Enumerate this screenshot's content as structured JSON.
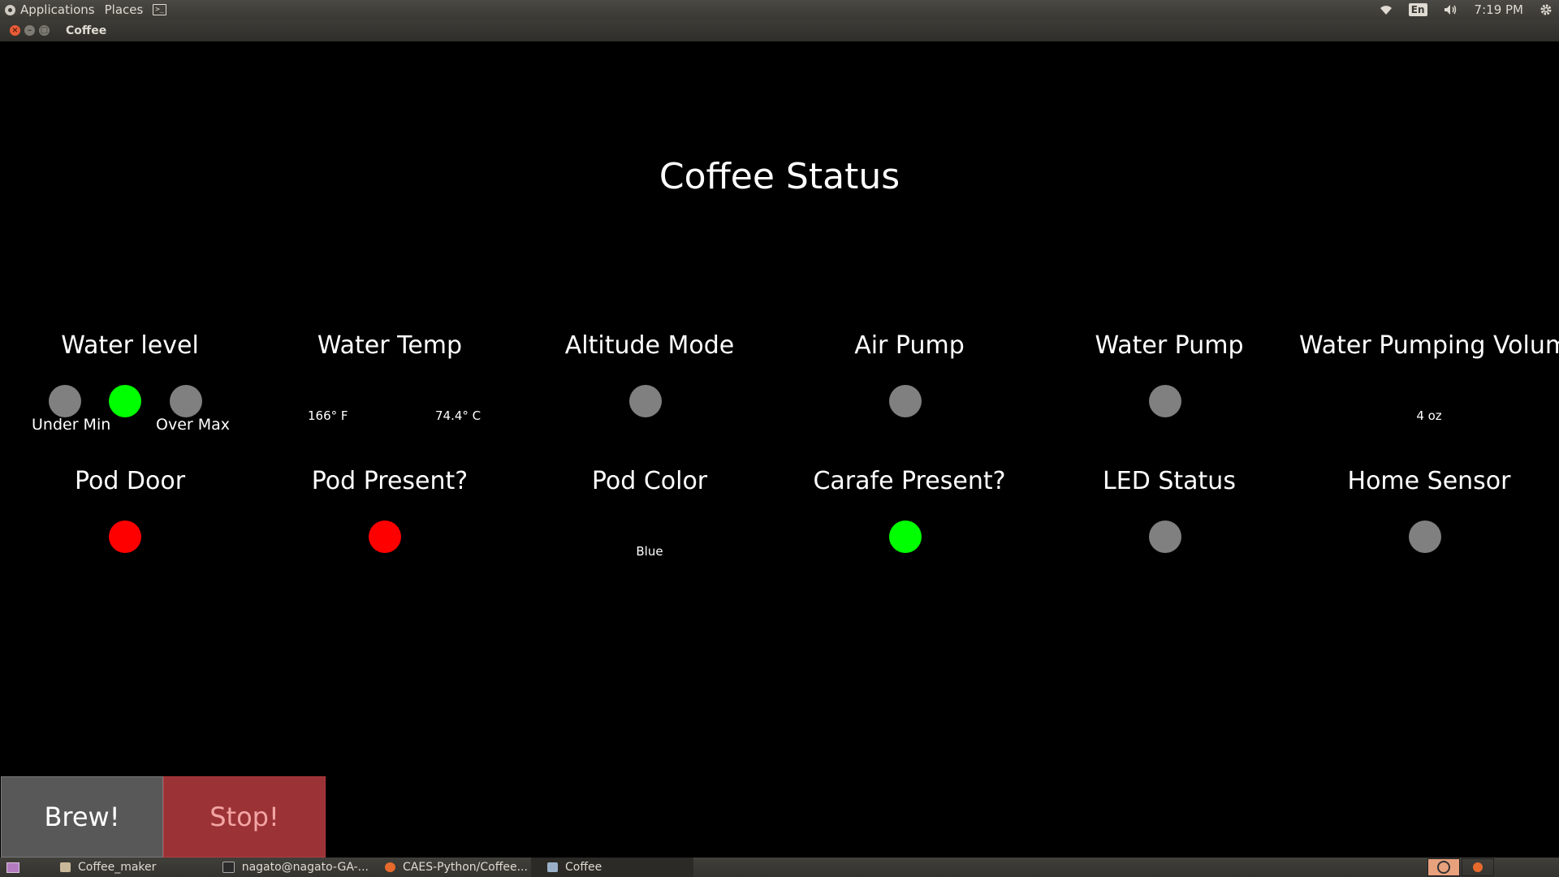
{
  "top_panel": {
    "applications_label": "Applications",
    "places_label": "Places",
    "terminal_glyph": ">_",
    "lang": "En",
    "time": "7:19 PM",
    "icons": [
      "wifi-icon",
      "volume-icon",
      "gear-icon"
    ]
  },
  "window": {
    "title": "Coffee",
    "close_glyph": "×",
    "min_glyph": "–",
    "max_glyph": "□"
  },
  "app": {
    "heading": "Coffee Status",
    "row1": [
      {
        "label": "Water level"
      },
      {
        "label": "Water Temp",
        "temp_f": "166° F",
        "temp_c": "74.4° C"
      },
      {
        "label": "Altitude Mode",
        "state": "off"
      },
      {
        "label": "Air Pump",
        "state": "off"
      },
      {
        "label": "Water Pump",
        "state": "off"
      },
      {
        "label": "Water Pumping Volume",
        "value": "4 oz"
      }
    ],
    "water_level": {
      "under_min_label": "Under Min",
      "over_max_label": "Over Max",
      "indicators": [
        "off",
        "on",
        "off"
      ]
    },
    "row2": [
      {
        "label": "Pod Door",
        "state": "alert"
      },
      {
        "label": "Pod Present?",
        "state": "alert"
      },
      {
        "label": "Pod Color",
        "value": "Blue"
      },
      {
        "label": "Carafe Present?",
        "state": "on"
      },
      {
        "label": "LED Status",
        "state": "off"
      },
      {
        "label": "Home Sensor",
        "state": "off"
      }
    ],
    "buttons": {
      "brew": "Brew!",
      "stop": "Stop!"
    },
    "colors": {
      "on": "#00ff00",
      "off": "#808080",
      "alert": "#ff0000",
      "brew": "#585858",
      "stop": "#9b3236"
    }
  },
  "taskbar": {
    "tasks": [
      {
        "label": "Coffee_maker",
        "icon": "folder-icon"
      },
      {
        "label": "nagato@nagato-GA-...",
        "icon": "terminal-icon"
      },
      {
        "label": "CAES-Python/Coffee...",
        "icon": "firefox-icon"
      },
      {
        "label": "Coffee",
        "icon": "python-icon"
      }
    ]
  }
}
